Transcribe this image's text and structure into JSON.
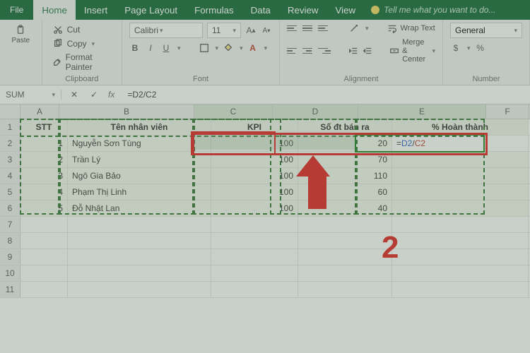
{
  "tabs": {
    "file": "File",
    "items": [
      "Home",
      "Insert",
      "Page Layout",
      "Formulas",
      "Data",
      "Review",
      "View"
    ],
    "active": "Home",
    "tell_me": "Tell me what you want to do..."
  },
  "ribbon": {
    "clipboard": {
      "cut": "Cut",
      "copy": "Copy",
      "paint": "Format Painter",
      "label": "Clipboard",
      "paste": "Paste"
    },
    "font": {
      "name": "Calibri",
      "size": "11",
      "label": "Font",
      "bold": "B",
      "italic": "I",
      "underline": "U"
    },
    "alignment": {
      "wrap": "Wrap Text",
      "merge": "Merge & Center",
      "label": "Alignment"
    },
    "number": {
      "format": "General",
      "label": "Number",
      "currency": "$",
      "percent": "%"
    }
  },
  "formula_bar": {
    "namebox": "SUM",
    "value": "=D2/C2"
  },
  "columns": [
    "A",
    "B",
    "C",
    "D",
    "E",
    "F"
  ],
  "rownums": [
    "1",
    "2",
    "3",
    "4",
    "5",
    "6",
    "7",
    "8",
    "9",
    "10",
    "11"
  ],
  "table": {
    "headers": {
      "stt": "STT",
      "name": "Tên nhân viên",
      "kpi": "KPI",
      "sold": "Số đt bán ra",
      "pct": "% Hoàn thành"
    },
    "rows": [
      {
        "stt": "1",
        "name": "Nguyễn Sơn Tùng",
        "kpi": "100",
        "sold": "20",
        "pct_formula": {
          "eq": "=",
          "d": "D2",
          "slash": "/",
          "c": "C2"
        }
      },
      {
        "stt": "2",
        "name": "Trần Lý",
        "kpi": "100",
        "sold": "70"
      },
      {
        "stt": "3",
        "name": "Ngô Gia Bảo",
        "kpi": "100",
        "sold": "110"
      },
      {
        "stt": "4",
        "name": "Phạm Thị Linh",
        "kpi": "100",
        "sold": "60"
      },
      {
        "stt": "5",
        "name": "Đỗ Nhật Lan",
        "kpi": "100",
        "sold": "40"
      }
    ]
  },
  "annotation": {
    "number": "2"
  }
}
